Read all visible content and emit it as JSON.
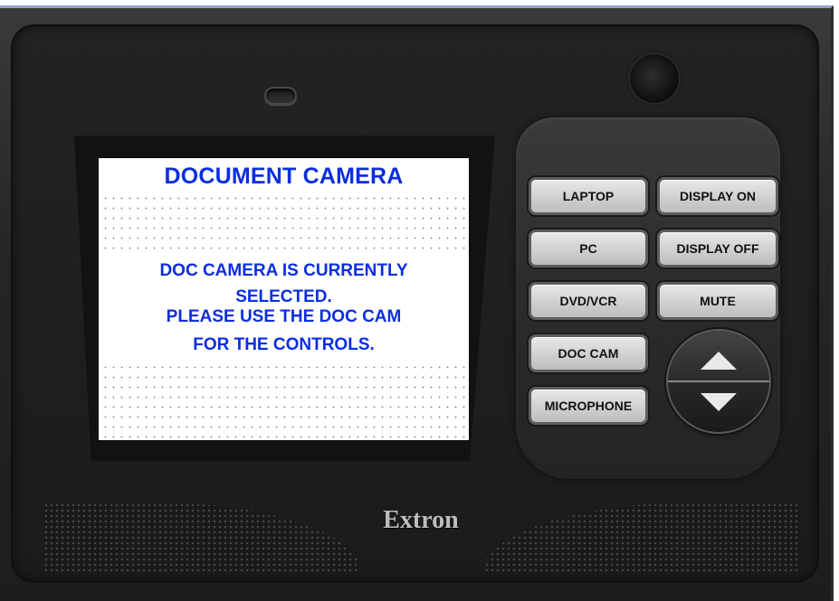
{
  "screen": {
    "title": "DOCUMENT CAMERA",
    "message_lines": [
      "DOC CAMERA IS CURRENTLY",
      "SELECTED.",
      "PLEASE USE THE DOC CAM",
      "FOR THE CONTROLS."
    ]
  },
  "buttons": {
    "laptop": "LAPTOP",
    "pc": "PC",
    "dvd_vcr": "DVD/VCR",
    "doc_cam": "DOC CAM",
    "microphone": "MICROPHONE",
    "display_on": "DISPLAY ON",
    "display_off": "DISPLAY OFF",
    "mute": "MUTE"
  },
  "rocker": {
    "up_icon": "triangle-up-icon",
    "down_icon": "triangle-down-icon"
  },
  "brand": "Extron",
  "colors": {
    "screen_text": "#0a2ee0",
    "device_body": "#1d1d1f",
    "button_face": "#d0d0d0"
  }
}
